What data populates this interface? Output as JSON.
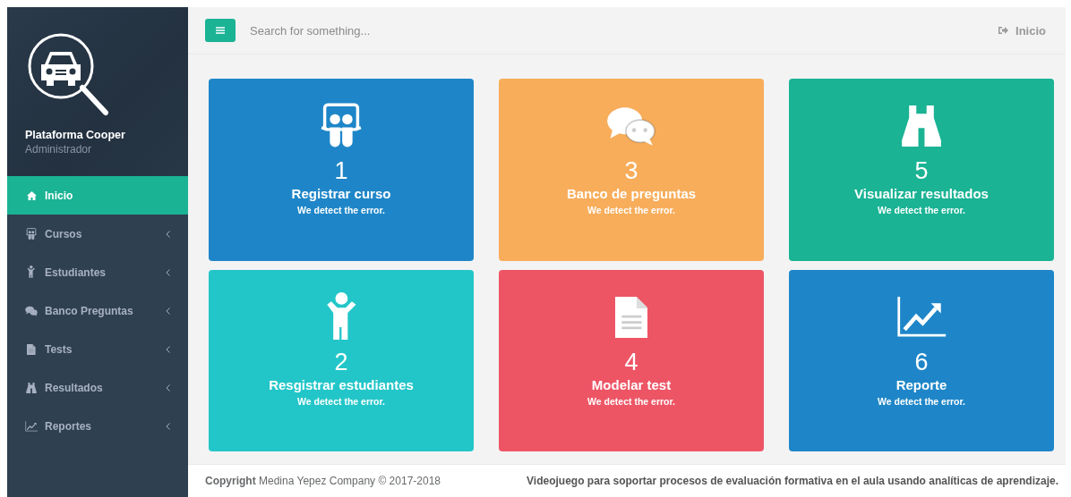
{
  "sidebar": {
    "title": "Plataforma Cooper",
    "role": "Administrador",
    "items": [
      {
        "label": "Inicio",
        "selected": true,
        "has_submenu": false
      },
      {
        "label": "Cursos",
        "selected": false,
        "has_submenu": true
      },
      {
        "label": "Estudiantes",
        "selected": false,
        "has_submenu": true
      },
      {
        "label": "Banco Preguntas",
        "selected": false,
        "has_submenu": true
      },
      {
        "label": "Tests",
        "selected": false,
        "has_submenu": true
      },
      {
        "label": "Resultados",
        "selected": false,
        "has_submenu": true
      },
      {
        "label": "Reportes",
        "selected": false,
        "has_submenu": true
      }
    ]
  },
  "topbar": {
    "search": {
      "placeholder": "Search for something..."
    },
    "logout_label": "Inicio"
  },
  "cards": [
    {
      "number": "1",
      "title": "Registrar curso",
      "subtitle": "We detect the error.",
      "color": "#1e86c8"
    },
    {
      "number": "3",
      "title": "Banco de preguntas",
      "subtitle": "We detect the error.",
      "color": "#f8ad5b"
    },
    {
      "number": "5",
      "title": "Visualizar resultados",
      "subtitle": "We detect the error.",
      "color": "#1ab394"
    },
    {
      "number": "2",
      "title": "Resgistrar estudiantes",
      "subtitle": "We detect the error.",
      "color": "#23c6c8"
    },
    {
      "number": "4",
      "title": "Modelar test",
      "subtitle": "We detect the error.",
      "color": "#ed5565"
    },
    {
      "number": "6",
      "title": "Reporte",
      "subtitle": "We detect the error.",
      "color": "#1e86c8"
    }
  ],
  "footer": {
    "copyright": "**Copyright** Medina Yepez Company © 2017-2018",
    "tagline": "Videojuego para soportar procesos de evaluación formativa en el aula usando analíticas de aprendizaje."
  }
}
